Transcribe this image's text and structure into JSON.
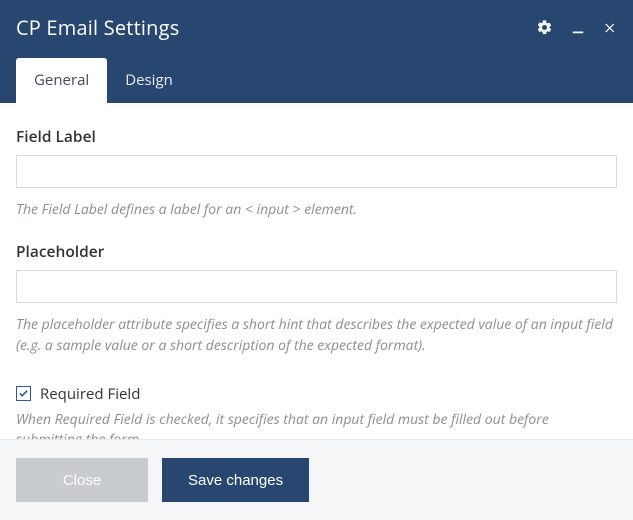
{
  "header": {
    "title": "CP Email Settings",
    "icons": {
      "settings": "gear-icon",
      "minimize": "minimize-icon",
      "close": "close-icon"
    }
  },
  "tabs": [
    {
      "id": "general",
      "label": "General",
      "active": true
    },
    {
      "id": "design",
      "label": "Design",
      "active": false
    }
  ],
  "fields": {
    "fieldLabel": {
      "label": "Field Label",
      "value": "",
      "help": "The Field Label defines a label for an < input > element."
    },
    "placeholder": {
      "label": "Placeholder",
      "value": "",
      "help": "The placeholder attribute specifies a short hint that describes the expected value of an input field (e.g. a sample value or a short description of the expected format)."
    },
    "required": {
      "label": "Required Field",
      "checked": true,
      "help": "When Required Field is checked, it specifies that an input field must be filled out before submitting the form."
    }
  },
  "footer": {
    "close": "Close",
    "save": "Save changes"
  }
}
